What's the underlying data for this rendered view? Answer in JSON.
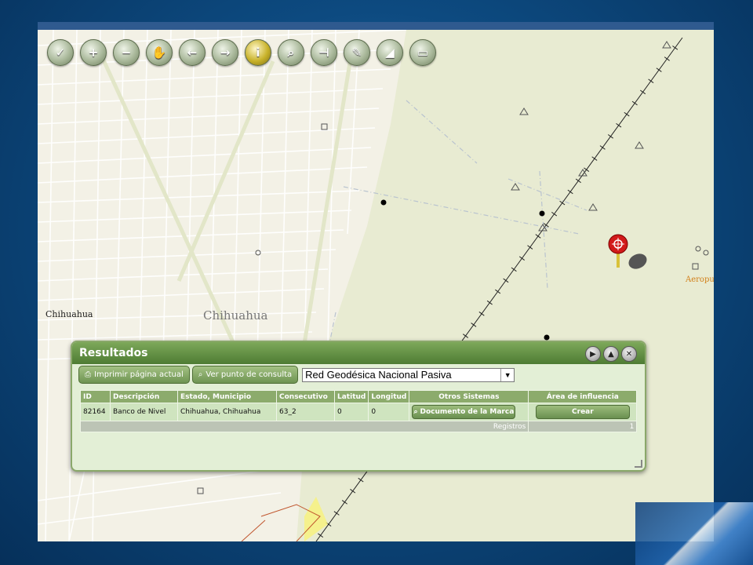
{
  "toolbar": [
    {
      "name": "check-icon",
      "glyph": "✓"
    },
    {
      "name": "zoom-in-icon",
      "glyph": "+"
    },
    {
      "name": "zoom-out-icon",
      "glyph": "−"
    },
    {
      "name": "pan-hand-icon",
      "glyph": "✋"
    },
    {
      "name": "back-arrow-icon",
      "glyph": "←"
    },
    {
      "name": "forward-arrow-icon",
      "glyph": "→"
    },
    {
      "name": "info-icon",
      "glyph": "i"
    },
    {
      "name": "binoculars-icon",
      "glyph": "⌕"
    },
    {
      "name": "measure-icon",
      "glyph": "⊣"
    },
    {
      "name": "pushpin-icon",
      "glyph": "✎"
    },
    {
      "name": "area-icon",
      "glyph": "◢"
    },
    {
      "name": "print-icon",
      "glyph": "▭"
    }
  ],
  "map_labels": {
    "city_small": "Chihuahua",
    "city_large": "Chihuahua",
    "airport": "Aeropuer"
  },
  "results": {
    "title": "Resultados",
    "print_button": "Imprimir página actual",
    "view_button": "Ver punto de consulta",
    "layer_select": "Red Geodésica Nacional Pasiva",
    "columns": [
      "ID",
      "Descripción",
      "Estado, Municipio",
      "Consecutivo",
      "Latitud",
      "Longitud",
      "Otros Sistemas",
      "Área de influencia"
    ],
    "row": {
      "id": "82164",
      "descripcion": "Banco de Nivel",
      "estado": "Chihuahua, Chihuahua",
      "consecutivo": "63_2",
      "latitud": "0",
      "longitud": "0",
      "otros_button": "Documento de la Marca",
      "area_button": "Crear"
    },
    "footer_label": "Registros",
    "footer_count": "1"
  },
  "colors": {
    "panel_header": "#4e7c33",
    "map_bg": "#f3f1e6",
    "map_green": "#e8ebd2",
    "pin": "#d11a1a"
  }
}
